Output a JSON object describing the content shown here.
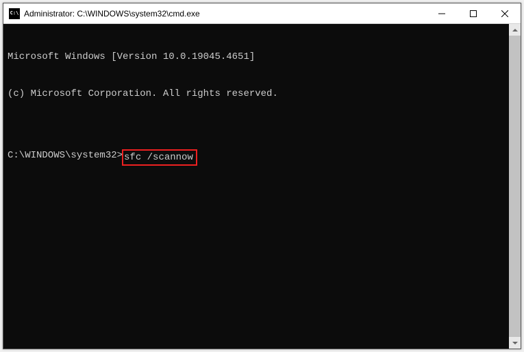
{
  "titlebar": {
    "icon_text": "C:\\",
    "title": "Administrator: C:\\WINDOWS\\system32\\cmd.exe"
  },
  "terminal": {
    "line1": "Microsoft Windows [Version 10.0.19045.4651]",
    "line2": "(c) Microsoft Corporation. All rights reserved.",
    "blank": "",
    "prompt": "C:\\WINDOWS\\system32>",
    "command": "sfc /scannow"
  }
}
